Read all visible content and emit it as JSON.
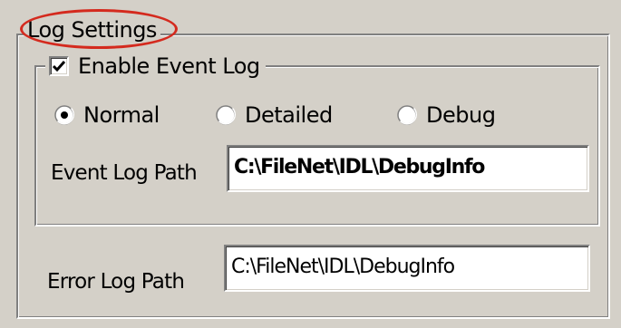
{
  "log_settings": {
    "title": "Log Settings",
    "enable_event_log": {
      "label": "Enable Event Log",
      "checked": true
    },
    "log_level": {
      "options": [
        {
          "label": "Normal",
          "selected": true
        },
        {
          "label": "Detailed",
          "selected": false
        },
        {
          "label": "Debug",
          "selected": false
        }
      ]
    },
    "event_log_path": {
      "label": "Event Log Path",
      "value": "C:\\FileNet\\IDL\\DebugInfo"
    },
    "error_log_path": {
      "label": "Error Log Path",
      "value": "C:\\FileNet\\IDL\\DebugInfo"
    }
  },
  "annotation": {
    "color": "#d42a1e",
    "shape": "ellipse-around-title"
  }
}
